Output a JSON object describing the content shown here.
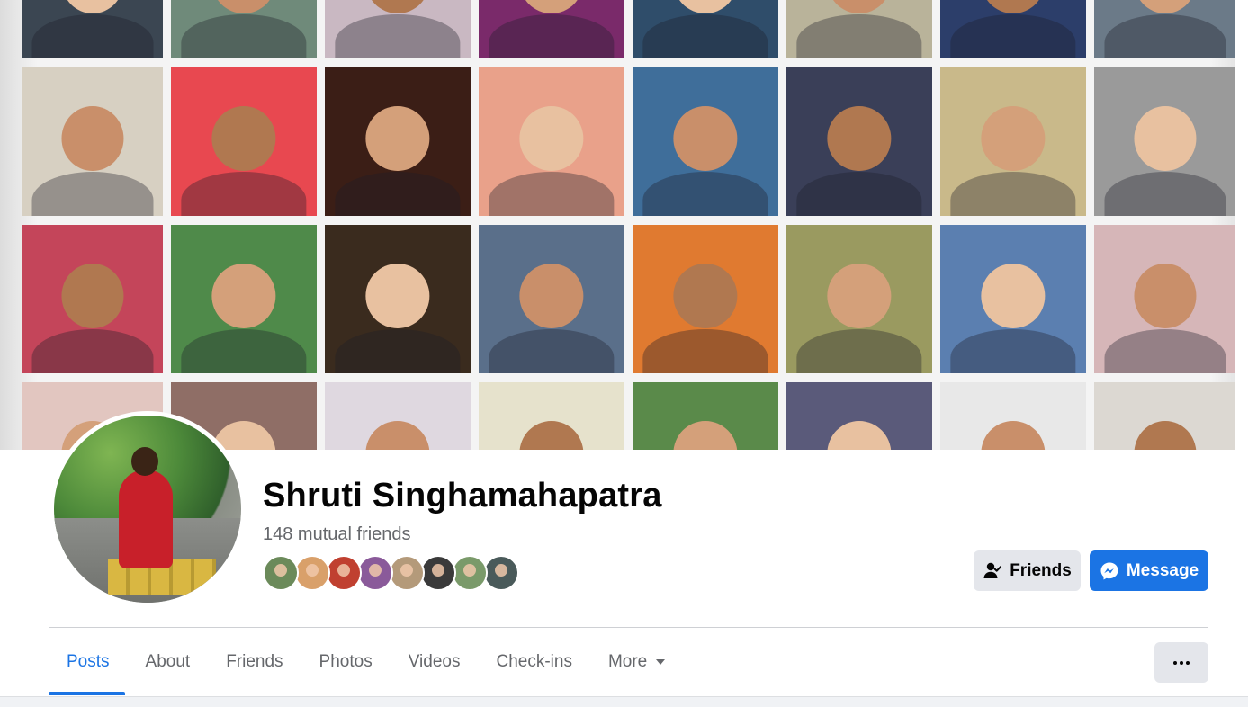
{
  "profile": {
    "name": "Shruti Singhamahapatra",
    "mutual_friends": "148 mutual friends"
  },
  "actions": {
    "friends_label": "Friends",
    "message_label": "Message"
  },
  "tabs": [
    {
      "label": "Posts",
      "active": true
    },
    {
      "label": "About"
    },
    {
      "label": "Friends"
    },
    {
      "label": "Photos"
    },
    {
      "label": "Videos"
    },
    {
      "label": "Check-ins"
    },
    {
      "label": "More",
      "has_caret": true
    }
  ],
  "colors": {
    "accent": "#1b74e4",
    "secondary_text": "#65676b",
    "button_gray": "#e4e6eb"
  },
  "icons": [
    "user-check-icon",
    "messenger-icon",
    "caret-down-icon",
    "more-dots-icon"
  ],
  "cover_tiles": [
    [
      "#3b4652",
      "#6f8a7a",
      "#c9b8c2",
      "#7a2a6a",
      "#2f4d6a",
      "#b9b39a",
      "#2c3e6a",
      "#6b7a88"
    ],
    [
      "#d7d0c2",
      "#e84850",
      "#3b1e16",
      "#e9a18a",
      "#3f6e9a",
      "#3a3f58",
      "#c9b98a",
      "#9a9a9a"
    ],
    [
      "#c4455a",
      "#4f8a4a",
      "#3a2b1e",
      "#5a6f8a",
      "#e07a30",
      "#9a9a60",
      "#5b7fb0",
      "#d6b6b8"
    ],
    [
      "#e2c6c0",
      "#8f6e66",
      "#dfd8e0",
      "#e6e2cc",
      "#5a8a4a",
      "#5a5a7a",
      "#e8e8e8",
      "#dcd8d2"
    ]
  ],
  "cover_skin": [
    "#e8c1a0",
    "#c98f6a",
    "#b07850",
    "#d4a07a"
  ],
  "mutual_face_colors": [
    "#6b8a5a",
    "#d9a06a",
    "#c04030",
    "#8a5a9a",
    "#b49a7a",
    "#3a3a3a",
    "#7a9a6a",
    "#4a5a5a"
  ]
}
